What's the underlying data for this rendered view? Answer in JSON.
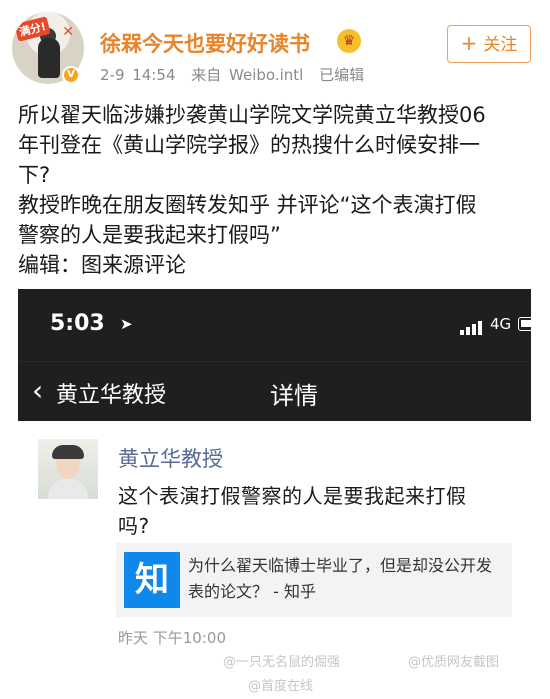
{
  "post": {
    "username": "徐槑今天也要好好读书",
    "vip_icon": "crown-emoji",
    "avatar_stamp": "满分!",
    "follow_label": "关注",
    "meta": {
      "date": "2-9 14:54",
      "source": "来自 Weibo.intl",
      "edited": "已编辑"
    },
    "text_lines": [
      "所以翟天临涉嫌抄袭黄山学院文学院黄立华教授06",
      "年刊登在《黄山学院学报》的热搜什么时候安排一",
      "下?",
      "教授昨晚在朋友圈转发知乎 并评论“这个表演打假",
      "警察的人是要我起来打假吗”",
      "编辑：图来源评论"
    ]
  },
  "screenshot": {
    "status_time": "5:03",
    "network": "4G",
    "back_label": "黄立华教授",
    "nav_title": "详情",
    "moment": {
      "author": "黄立华教授",
      "text_lines": [
        "这个表演打假警察的人是要我起来打假",
        "吗?"
      ],
      "link_logo": "知",
      "link_title": "为什么翟天临博士毕业了，但是却没公开发表的论文？ - 知乎",
      "time": "昨天 下午10:00"
    }
  },
  "watermarks": [
    "@一只无名鼠的倔强",
    "@优质网友截图",
    "@首度在线"
  ]
}
